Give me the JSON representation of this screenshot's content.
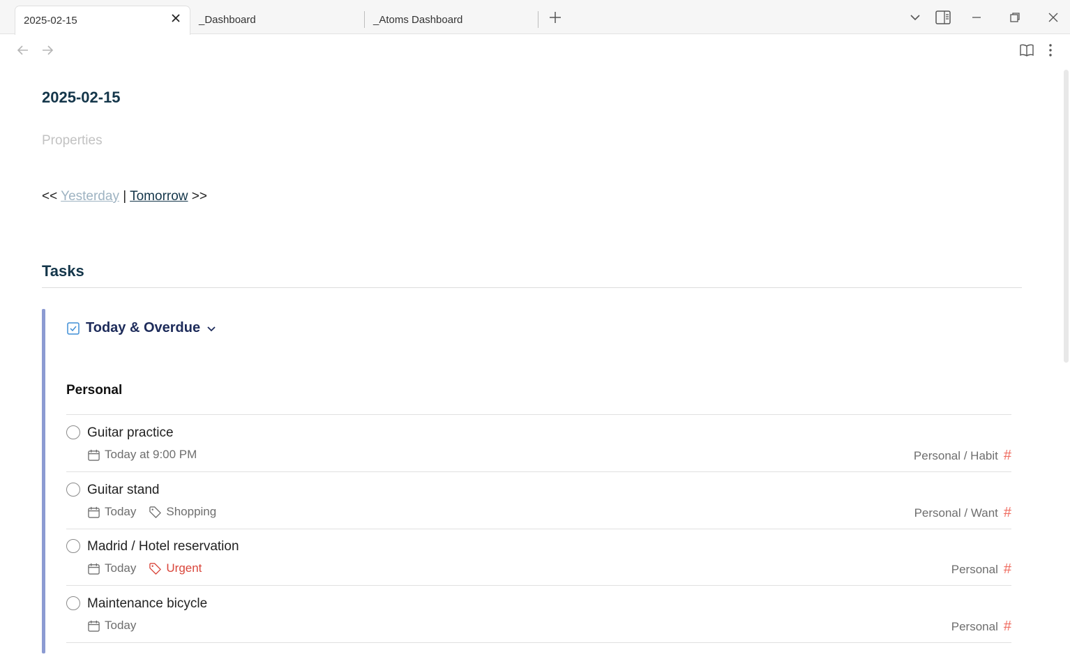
{
  "tabs": [
    {
      "label": "2025-02-15",
      "active": true
    },
    {
      "label": "_Dashboard",
      "active": false
    },
    {
      "label": "_Atoms Dashboard",
      "active": false
    }
  ],
  "note": {
    "title": "2025-02-15",
    "properties_label": "Properties",
    "daynav": {
      "prev_arrows": "<<",
      "yesterday": "Yesterday",
      "separator": "|",
      "tomorrow": "Tomorrow",
      "next_arrows": ">>"
    }
  },
  "tasks_section": {
    "heading": "Tasks",
    "query_title": "Today & Overdue",
    "group": "Personal",
    "items": [
      {
        "name": "Guitar practice",
        "date": "Today at 9:00 PM",
        "label": "",
        "urgent": false,
        "project": "Personal / Habit"
      },
      {
        "name": "Guitar stand",
        "date": "Today",
        "label": "Shopping",
        "urgent": false,
        "project": "Personal / Want"
      },
      {
        "name": "Madrid / Hotel reservation",
        "date": "Today",
        "label": "Urgent",
        "urgent": true,
        "project": "Personal"
      },
      {
        "name": "Maintenance bicycle",
        "date": "Today",
        "label": "",
        "urgent": false,
        "project": "Personal"
      }
    ]
  },
  "colors": {
    "accent_bar": "#8c9bd2",
    "heading": "#14364a",
    "urgent": "#d9453a",
    "hash": "#ef6b5f"
  },
  "icons": {
    "project_hash": "#"
  }
}
